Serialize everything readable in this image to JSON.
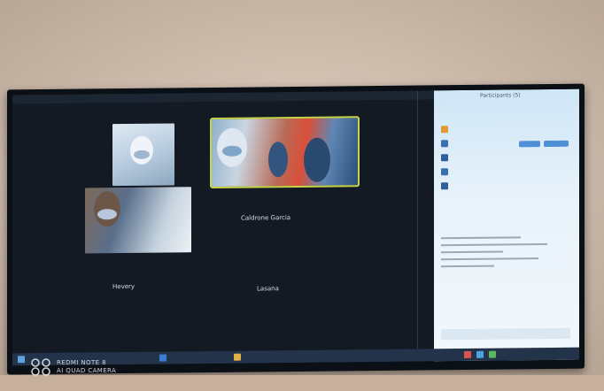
{
  "scene": {
    "video_tiles": [
      {
        "name": "",
        "shown": true
      },
      {
        "name": "",
        "shown": true
      },
      {
        "name": "",
        "shown": true
      }
    ],
    "name_labels": [
      "Caldrone Garcia",
      "Hevery",
      "Lasana"
    ],
    "panel": {
      "title": "Participants (5)",
      "rows": [
        "",
        "",
        "",
        "",
        ""
      ]
    },
    "watermark": {
      "line1": "REDMI NOTE 8",
      "line2": "AI QUAD CAMERA"
    }
  }
}
